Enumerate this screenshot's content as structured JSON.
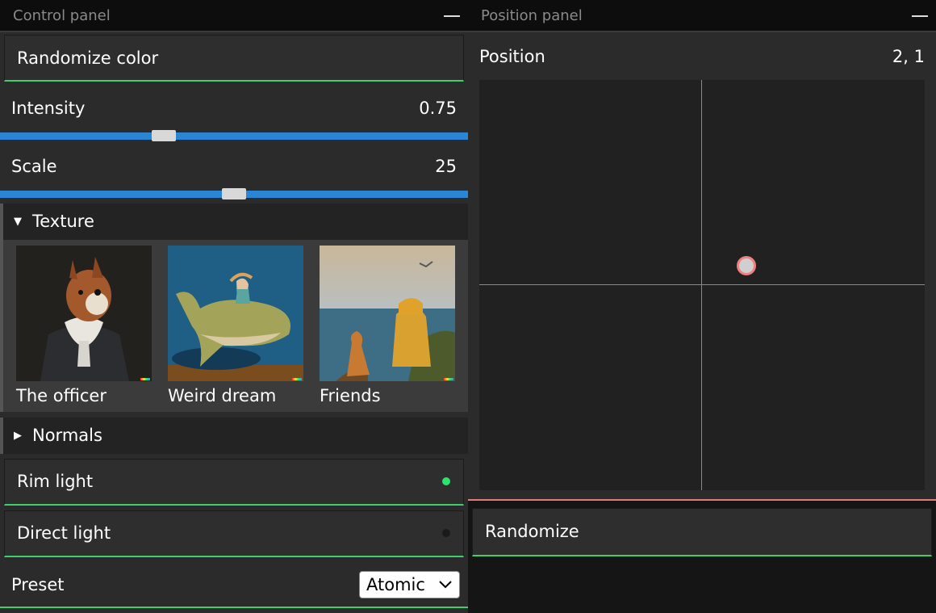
{
  "control_panel": {
    "title": "Control panel",
    "randomize_color_label": "Randomize color",
    "intensity": {
      "label": "Intensity",
      "value": "0.75",
      "fraction": 0.35
    },
    "scale": {
      "label": "Scale",
      "value": "25",
      "fraction": 0.5
    },
    "texture": {
      "header": "Texture",
      "items": [
        {
          "caption": "The officer"
        },
        {
          "caption": "Weird dream"
        },
        {
          "caption": "Friends"
        }
      ]
    },
    "normals_header": "Normals",
    "rim_light": {
      "label": "Rim light",
      "on": true
    },
    "direct_light": {
      "label": "Direct light",
      "on": false
    },
    "preset": {
      "label": "Preset",
      "selected": "Atomic"
    }
  },
  "position_panel": {
    "title": "Position panel",
    "label": "Position",
    "value": "2, 1",
    "randomize_label": "Randomize"
  },
  "colors": {
    "accent_green": "#3ecf6f",
    "slider_blue": "#2a85d4",
    "point_outline": "#f08080",
    "indicator_on": "#2ee36a",
    "indicator_off": "#1a1a1a"
  }
}
